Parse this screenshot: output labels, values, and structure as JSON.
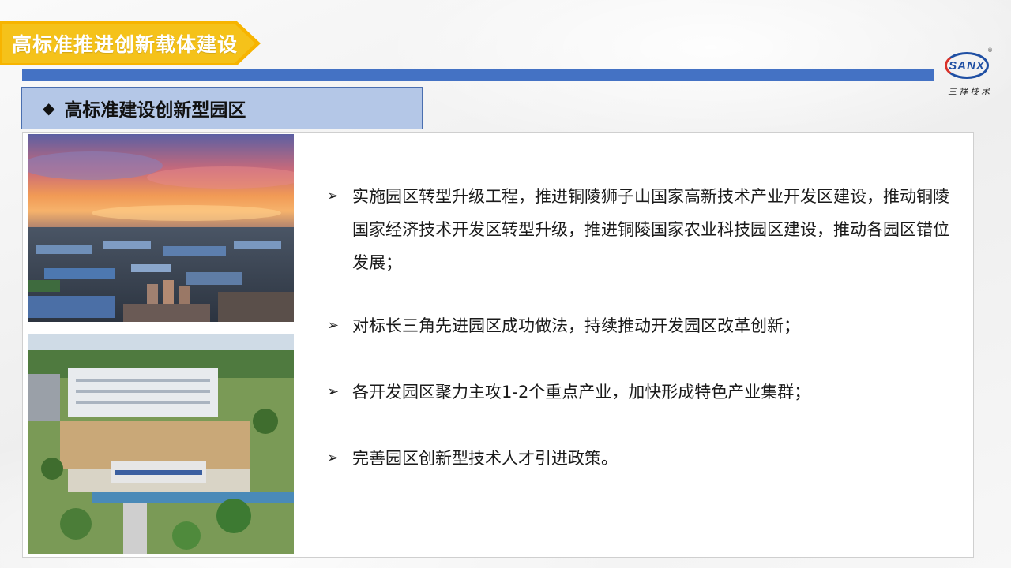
{
  "header": {
    "title": "高标准推进创新载体建设",
    "banner_color": "#f5c21a",
    "rule_color": "#4472c4"
  },
  "logo": {
    "mark": "SANX",
    "registered": "®",
    "name_cn": "三祥技术"
  },
  "section": {
    "marker_icon": "diamond-icon",
    "heading": "高标准建设创新型园区",
    "box_color": "#b4c7e7"
  },
  "photos": [
    {
      "name": "industrial-park-sunset-aerial-photo"
    },
    {
      "name": "park-building-aerial-photo"
    }
  ],
  "bullets": [
    {
      "icon": "arrowhead-bullet-icon",
      "text": "实施园区转型升级工程，推进铜陵狮子山国家高新技术产业开发区建设，推动铜陵国家经济技术开发区转型升级，推进铜陵国家农业科技园区建设，推动各园区错位发展；"
    },
    {
      "icon": "arrowhead-bullet-icon",
      "text": "对标长三角先进园区成功做法，持续推动开发园区改革创新；"
    },
    {
      "icon": "arrowhead-bullet-icon",
      "text": "各开发园区聚力主攻1-2个重点产业，加快形成特色产业集群；"
    },
    {
      "icon": "arrowhead-bullet-icon",
      "text": "完善园区创新型技术人才引进政策。"
    }
  ]
}
